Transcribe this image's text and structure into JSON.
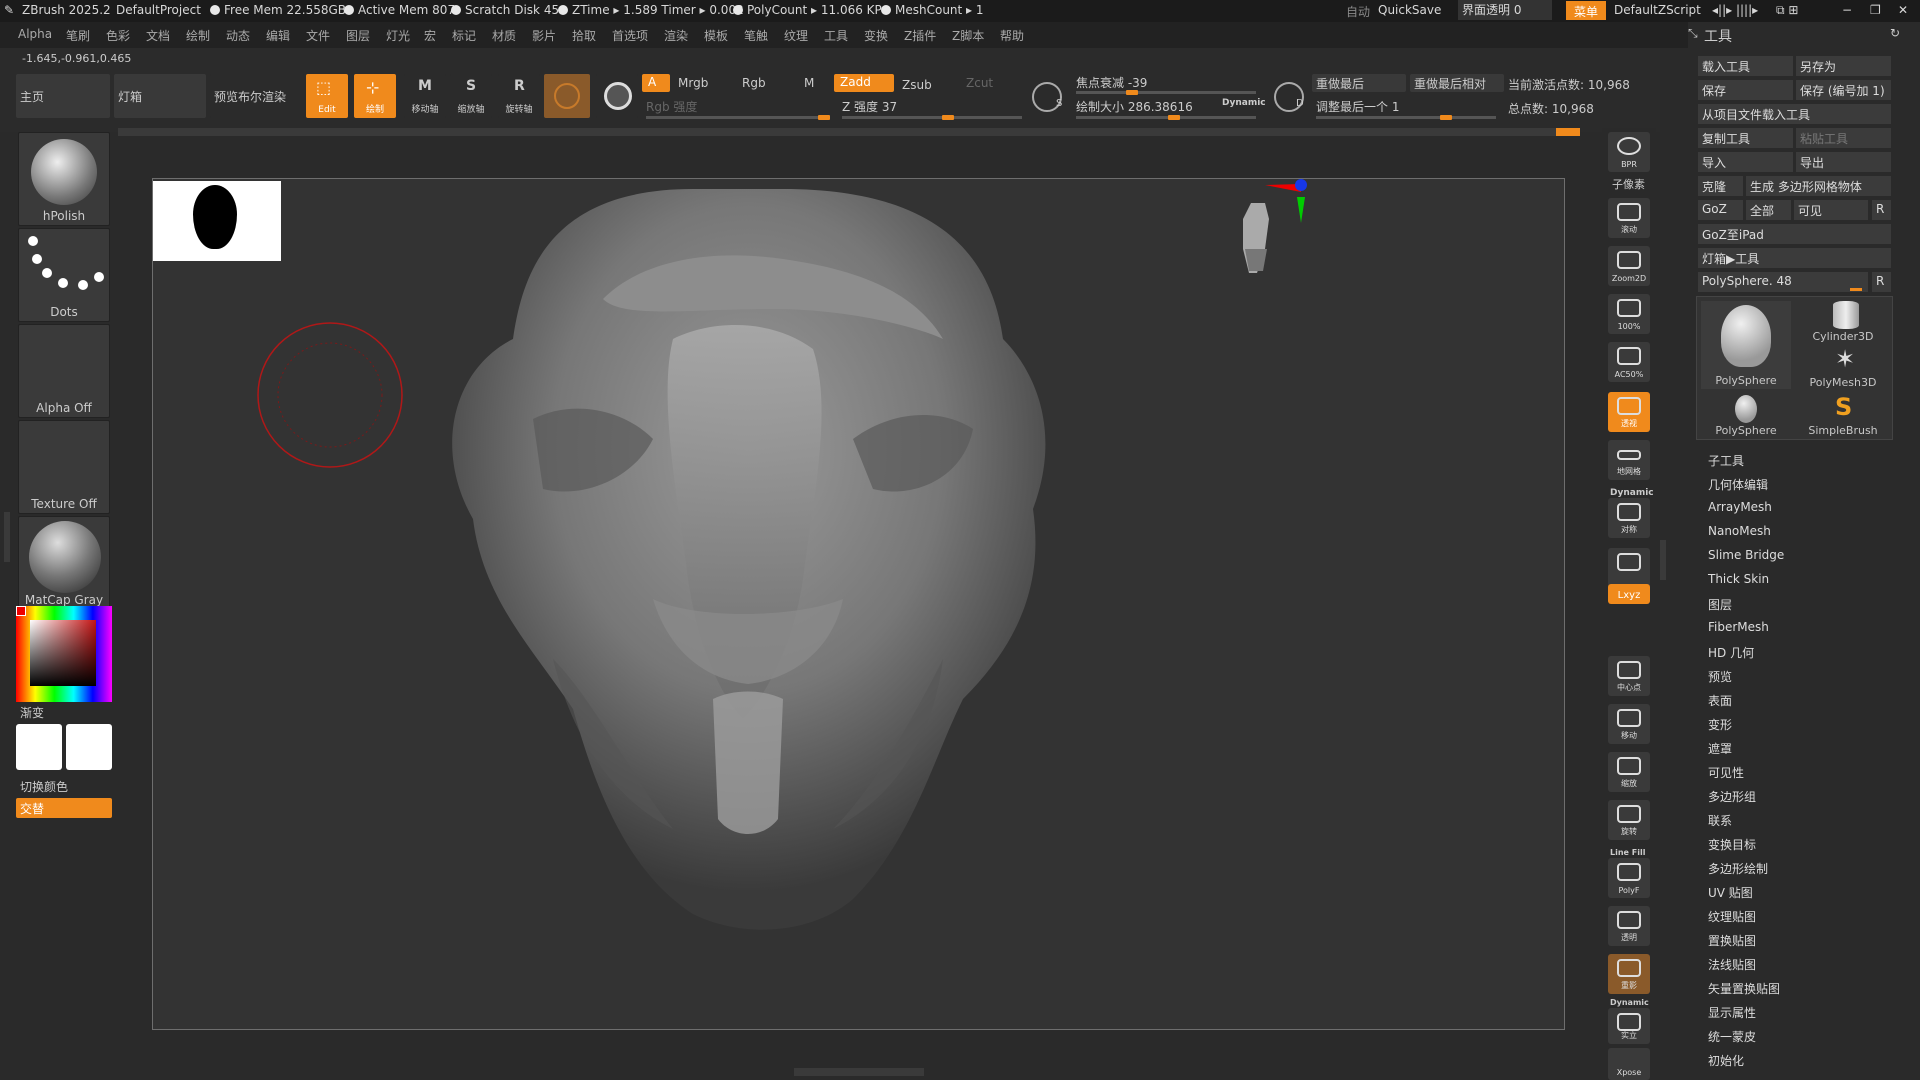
{
  "titlebar": {
    "app": "ZBrush 2025.2",
    "project": "DefaultProject",
    "free_mem": "Free Mem 22.558GB",
    "active_mem": "Active Mem 807",
    "scratch": "Scratch Disk 45",
    "ztime": "ZTime ▸ 1.589 Timer ▸ 0.002",
    "polycount": "PolyCount ▸ 11.066 KP",
    "meshcount": "MeshCount ▸ 1",
    "auto": "自动",
    "quicksave": "QuickSave",
    "transparency": "界面透明 0",
    "menu": "菜单",
    "script": "DefaultZScript"
  },
  "menubar": [
    "Alpha",
    "笔刷",
    "色彩",
    "文档",
    "绘制",
    "动态",
    "编辑",
    "文件",
    "图层",
    "灯光",
    "宏",
    "标记",
    "材质",
    "影片",
    "拾取",
    "首选项",
    "渲染",
    "模板",
    "笔触",
    "纹理",
    "工具",
    "变换",
    "Z插件",
    "Z脚本",
    "帮助"
  ],
  "coords": "-1.645,-0.961,0.465",
  "toolbar": {
    "home": "主页",
    "lightbox": "灯箱",
    "preview_bool": "预览布尔渲染",
    "edit": "Edit",
    "draw": "绘制",
    "move": "移动轴",
    "scale": "缩放轴",
    "rotate": "旋转轴",
    "a": "A",
    "mrgb": "Mrgb",
    "rgb": "Rgb",
    "m": "M",
    "rgb_intensity": "Rgb 强度",
    "zadd": "Zadd",
    "zsub": "Zsub",
    "zcut": "Zcut",
    "z_intensity": "Z 强度 37",
    "focal": "焦点衰减 -39",
    "draw_size": "绘制大小 286.38616",
    "dynamic": "Dynamic",
    "redo_last": "重做最后",
    "redo_last_rel": "重做最后相对",
    "adjust_last": "调整最后一个 1",
    "active_points": "当前激活点数: 10,968",
    "total_points": "总点数: 10,968",
    "s": "S",
    "d": "D"
  },
  "left": {
    "brush": "hPolish",
    "stroke": "Dots",
    "alpha": "Alpha Off",
    "texture": "Texture Off",
    "material": "MatCap Gray",
    "gradient": "渐变",
    "switch_color": "切换颜色",
    "alternate": "交替"
  },
  "strip": [
    "BPR",
    "子像素",
    "滚动",
    "Zoom2D",
    "100%",
    "AC50%",
    "透视",
    "地网格",
    "Dynamic",
    "对称",
    "",
    "Lxyz",
    "",
    "",
    "中心点",
    "移动",
    "缩放",
    "旋转",
    "Line Fill",
    "PolyF",
    "透明",
    "重影",
    "Dynamic",
    "实立",
    "Xpose"
  ],
  "tool": {
    "header": "工具",
    "load": "载入工具",
    "save_as": "另存为",
    "save": "保存",
    "save_inc": "保存 (编号加 1)",
    "load_from_project": "从项目文件载入工具",
    "copy": "复制工具",
    "paste": "粘贴工具",
    "import": "导入",
    "export": "导出",
    "clone": "克隆",
    "make_polymesh": "生成 多边形网格物体",
    "goz": "GoZ",
    "all": "全部",
    "visible": "可见",
    "r": "R",
    "goz_ipad": "GoZ至iPad",
    "lightbox_tool": "灯箱▶工具",
    "current": "PolySphere. 48",
    "thumbs": [
      "PolySphere",
      "Cylinder3D",
      "PolyMesh3D",
      "PolySphere",
      "SimpleBrush"
    ],
    "subpalettes": [
      "子工具",
      "几何体编辑",
      "ArrayMesh",
      "NanoMesh",
      "Slime Bridge",
      "Thick Skin",
      "图层",
      "FiberMesh",
      "HD 几何",
      "预览",
      "表面",
      "变形",
      "遮罩",
      "可见性",
      "多边形组",
      "联系",
      "变换目标",
      "多边形绘制",
      "UV 贴图",
      "纹理贴图",
      "置换贴图",
      "法线贴图",
      "矢量置换贴图",
      "显示属性",
      "统一蒙皮",
      "初始化"
    ]
  },
  "colors": {
    "accent": "#f08a1c"
  }
}
